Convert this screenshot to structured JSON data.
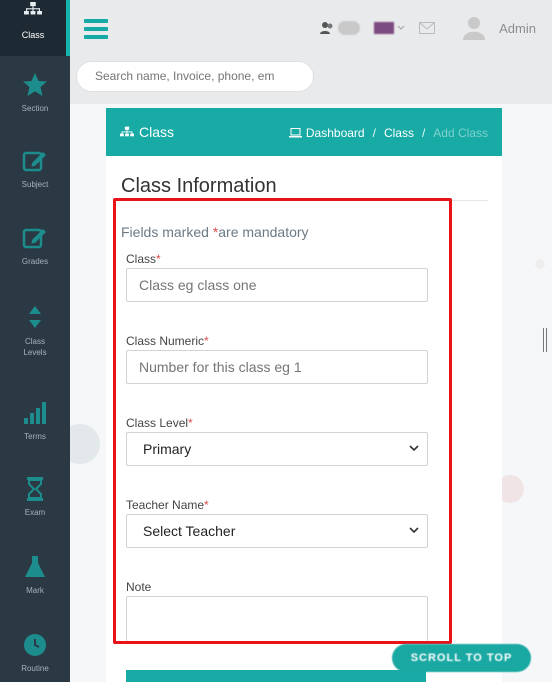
{
  "sidebar": {
    "items": [
      {
        "label": "Class",
        "icon": "sitemap-icon",
        "active": true
      },
      {
        "label": "Section",
        "icon": "star-icon"
      },
      {
        "label": "Subject",
        "icon": "edit-icon"
      },
      {
        "label": "Grades",
        "icon": "edit-icon"
      },
      {
        "label": "Class Levels",
        "icon": "sort-icon"
      },
      {
        "label": "Terms",
        "icon": "signal-icon"
      },
      {
        "label": "Exam",
        "icon": "hourglass-icon"
      },
      {
        "label": "Mark",
        "icon": "flask-icon"
      },
      {
        "label": "Routine",
        "icon": "clock-icon"
      }
    ]
  },
  "topbar": {
    "search_placeholder": "Search name, Invoice, phone, em",
    "user_name": "Admin"
  },
  "card": {
    "title": "Class",
    "breadcrumbs": [
      "Dashboard",
      "Class",
      "Add Class"
    ],
    "breadcrumb_sep": "/"
  },
  "form": {
    "section_title": "Class Information",
    "mandatory_prefix": "Fields marked ",
    "mandatory_star": "*",
    "mandatory_suffix": "are mandatory",
    "required_mark": "*",
    "fields": {
      "class_label": "Class",
      "class_placeholder": "Class eg class one",
      "class_numeric_label": "Class Numeric",
      "class_numeric_placeholder": "Number for this class eg 1",
      "class_level_label": "Class Level",
      "class_level_value": "Primary",
      "teacher_label": "Teacher Name",
      "teacher_value": "Select Teacher",
      "note_label": "Note"
    }
  },
  "scroll_top_label": "SCROLL TO TOP",
  "colors": {
    "accent": "#18aaa5",
    "sidebar_bg": "#2b3944",
    "highlight_border": "#e8141a",
    "required": "#e34b4b"
  }
}
